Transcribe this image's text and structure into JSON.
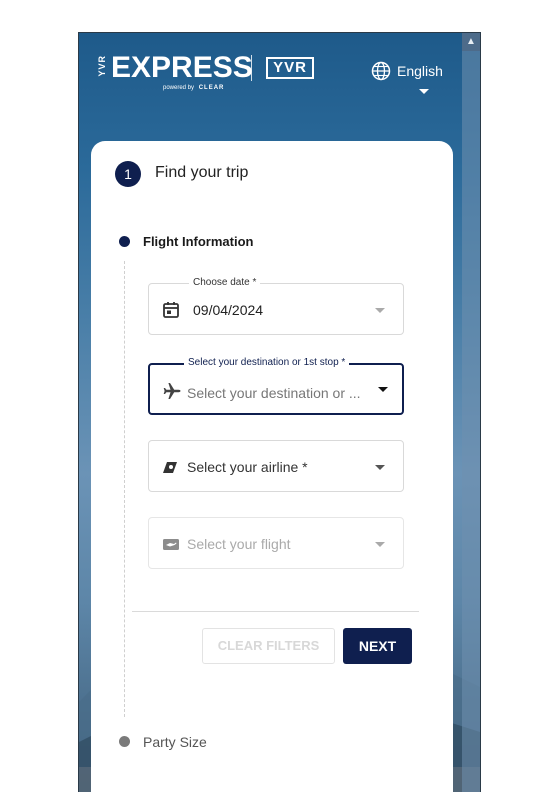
{
  "header": {
    "logo_prefix": "YVR",
    "logo_main": "EXPRESS",
    "powered_by": "powered by",
    "powered_partner": "CLEAR",
    "logo_partner": "YVR",
    "language": "English"
  },
  "step": {
    "number": "1",
    "title": "Find your trip"
  },
  "timeline": {
    "flight_info_label": "Flight Information",
    "party_size_label": "Party Size"
  },
  "fields": {
    "date": {
      "label": "Choose date *",
      "value": "09/04/2024",
      "icon": "calendar-icon"
    },
    "destination": {
      "label": "Select your destination or 1st stop *",
      "placeholder": "Select your destination or ...",
      "icon": "airplane-icon"
    },
    "airline": {
      "placeholder": "Select your airline *",
      "icon": "airline-tail-icon"
    },
    "flight": {
      "placeholder": "Select your flight",
      "icon": "flight-ticket-icon"
    }
  },
  "buttons": {
    "clear_filters": "CLEAR FILTERS",
    "next": "NEXT"
  },
  "colors": {
    "primary": "#0f1f4f",
    "header_bg": "#1e5a8a"
  }
}
